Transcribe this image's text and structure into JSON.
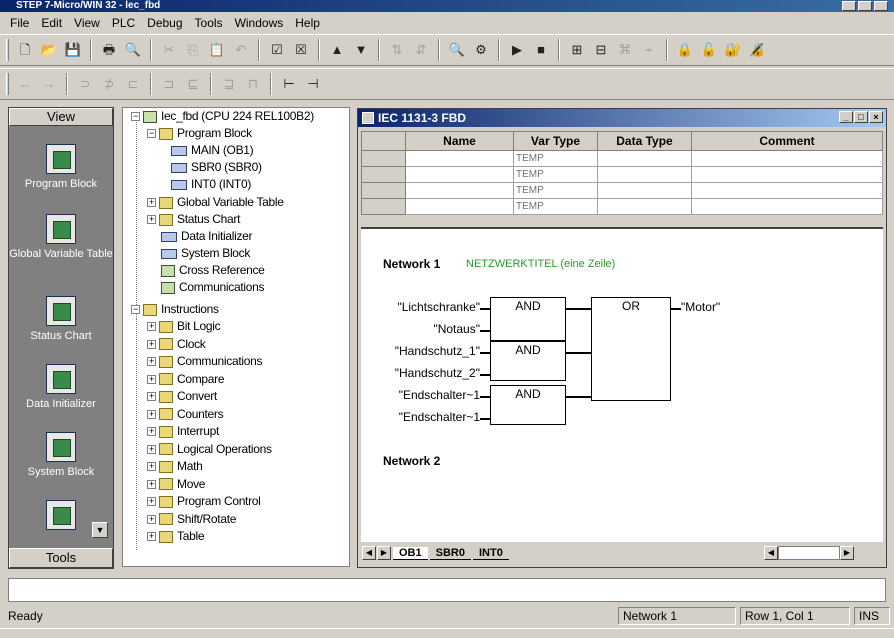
{
  "window": {
    "title": "STEP 7-Micro/WIN 32 - lec_fbd"
  },
  "menu": [
    "File",
    "Edit",
    "View",
    "PLC",
    "Debug",
    "Tools",
    "Windows",
    "Help"
  ],
  "toolbar1": [
    {
      "icon": "new-icon",
      "glyph": "🗋"
    },
    {
      "icon": "open-icon",
      "glyph": "📂"
    },
    {
      "icon": "save-icon",
      "glyph": "💾"
    },
    {
      "sep": true
    },
    {
      "icon": "print-icon",
      "glyph": "🖶"
    },
    {
      "icon": "print-preview-icon",
      "glyph": "🔍"
    },
    {
      "sep": true
    },
    {
      "icon": "cut-icon",
      "glyph": "✂",
      "disabled": true
    },
    {
      "icon": "copy-icon",
      "glyph": "⎘",
      "disabled": true
    },
    {
      "icon": "paste-icon",
      "glyph": "📋",
      "disabled": true
    },
    {
      "icon": "undo-icon",
      "glyph": "↶",
      "disabled": true
    },
    {
      "sep": true
    },
    {
      "icon": "compile-icon",
      "glyph": "☑"
    },
    {
      "icon": "compile-all-icon",
      "glyph": "☒"
    },
    {
      "sep": true
    },
    {
      "icon": "upload-icon",
      "glyph": "▲"
    },
    {
      "icon": "download-icon",
      "glyph": "▼"
    },
    {
      "sep": true
    },
    {
      "icon": "sort-ascending-icon",
      "glyph": "⇅",
      "disabled": true
    },
    {
      "icon": "sort-descending-icon",
      "glyph": "⇵",
      "disabled": true
    },
    {
      "sep": true
    },
    {
      "icon": "find-icon",
      "glyph": "🔍"
    },
    {
      "icon": "options-icon",
      "glyph": "⚙"
    },
    {
      "sep": true
    },
    {
      "icon": "run-icon",
      "glyph": "▶"
    },
    {
      "icon": "stop-icon",
      "glyph": "■"
    },
    {
      "sep": true
    },
    {
      "icon": "program-status-icon",
      "glyph": "⊞"
    },
    {
      "icon": "chart-status-icon",
      "glyph": "⊟"
    },
    {
      "icon": "single-read-icon",
      "glyph": "⌘",
      "disabled": true
    },
    {
      "icon": "write-all-icon",
      "glyph": "⌁",
      "disabled": true
    },
    {
      "sep": true
    },
    {
      "icon": "force-icon",
      "glyph": "🔒",
      "disabled": true
    },
    {
      "icon": "unforce-icon",
      "glyph": "🔓",
      "disabled": true
    },
    {
      "icon": "unforce-all-icon",
      "glyph": "🔐"
    },
    {
      "icon": "read-forced-icon",
      "glyph": "🔏",
      "disabled": true
    }
  ],
  "toolbar2": [
    {
      "icon": "nav-back-icon",
      "glyph": "←",
      "disabled": true
    },
    {
      "icon": "nav-forward-icon",
      "glyph": "→",
      "disabled": true
    },
    {
      "sep": true
    },
    {
      "icon": "insert-contact-icon",
      "glyph": "⊃",
      "disabled": true
    },
    {
      "icon": "insert-coil-icon",
      "glyph": "⊅",
      "disabled": true
    },
    {
      "icon": "insert-box-icon",
      "glyph": "⊏",
      "disabled": true
    },
    {
      "sep": true
    },
    {
      "icon": "line-up-icon",
      "glyph": "⊐",
      "disabled": true
    },
    {
      "icon": "line-down-icon",
      "glyph": "⊑",
      "disabled": true
    },
    {
      "sep": true
    },
    {
      "icon": "line-left-icon",
      "glyph": "⊒",
      "disabled": true
    },
    {
      "icon": "line-right-icon",
      "glyph": "⊓",
      "disabled": true
    },
    {
      "sep": true
    },
    {
      "icon": "network-icon",
      "glyph": "⊢"
    },
    {
      "icon": "network-delete-icon",
      "glyph": "⊣"
    }
  ],
  "viewbar": {
    "header": "View",
    "footer": "Tools",
    "items": [
      {
        "label": "Program Block",
        "icon": "program-block-icon"
      },
      {
        "label": "Global Variable Table",
        "icon": "global-variable-table-icon"
      },
      {
        "label": "Status Chart",
        "icon": "status-chart-icon"
      },
      {
        "label": "Data Initializer",
        "icon": "data-initializer-icon"
      },
      {
        "label": "System Block",
        "icon": "system-block-icon"
      },
      {
        "label": "",
        "icon": "cross-reference-icon"
      }
    ]
  },
  "tree": {
    "root": "Iec_fbd (CPU 224 REL100B2)",
    "program_block": "Program Block",
    "program_children": [
      "MAIN (OB1)",
      "SBR0 (SBR0)",
      "INT0 (INT0)"
    ],
    "global_var": "Global Variable Table",
    "status_chart": "Status Chart",
    "data_init": "Data Initializer",
    "system_block": "System Block",
    "cross_ref": "Cross Reference",
    "communications": "Communications",
    "instructions": "Instructions",
    "instruction_children": [
      "Bit Logic",
      "Clock",
      "Communications",
      "Compare",
      "Convert",
      "Counters",
      "Interrupt",
      "Logical Operations",
      "Math",
      "Move",
      "Program Control",
      "Shift/Rotate",
      "Table"
    ]
  },
  "editor": {
    "title": "IEC 1131-3 FBD",
    "columns": [
      "Name",
      "Var Type",
      "Data Type",
      "Comment"
    ],
    "rows": [
      {
        "name": "",
        "var_type": "TEMP",
        "data_type": "",
        "comment": ""
      },
      {
        "name": "",
        "var_type": "TEMP",
        "data_type": "",
        "comment": ""
      },
      {
        "name": "",
        "var_type": "TEMP",
        "data_type": "",
        "comment": ""
      },
      {
        "name": "",
        "var_type": "TEMP",
        "data_type": "",
        "comment": ""
      }
    ],
    "network1_label": "Network 1",
    "network1_title": "NETZWERKTITEL (eine Zeile)",
    "network2_label": "Network 2",
    "gates": {
      "and": "AND",
      "or": "OR"
    },
    "signals": {
      "in1": "\"Lichtschranke\"",
      "in2": "\"Notaus\"",
      "in3": "\"Handschutz_1\"",
      "in4": "\"Handschutz_2\"",
      "in5": "\"Endschalter~1",
      "in6": "\"Endschalter~1",
      "out": "\"Motor\""
    },
    "tabs": [
      "OB1",
      "SBR0",
      "INT0"
    ]
  },
  "status": {
    "ready": "Ready",
    "network": "Network 1",
    "position": "Row 1, Col 1",
    "mode": "INS"
  },
  "colors": {
    "titlebar": "#0a246a",
    "network_title": "#2a9a2a",
    "viewbar_bg": "#808080"
  }
}
